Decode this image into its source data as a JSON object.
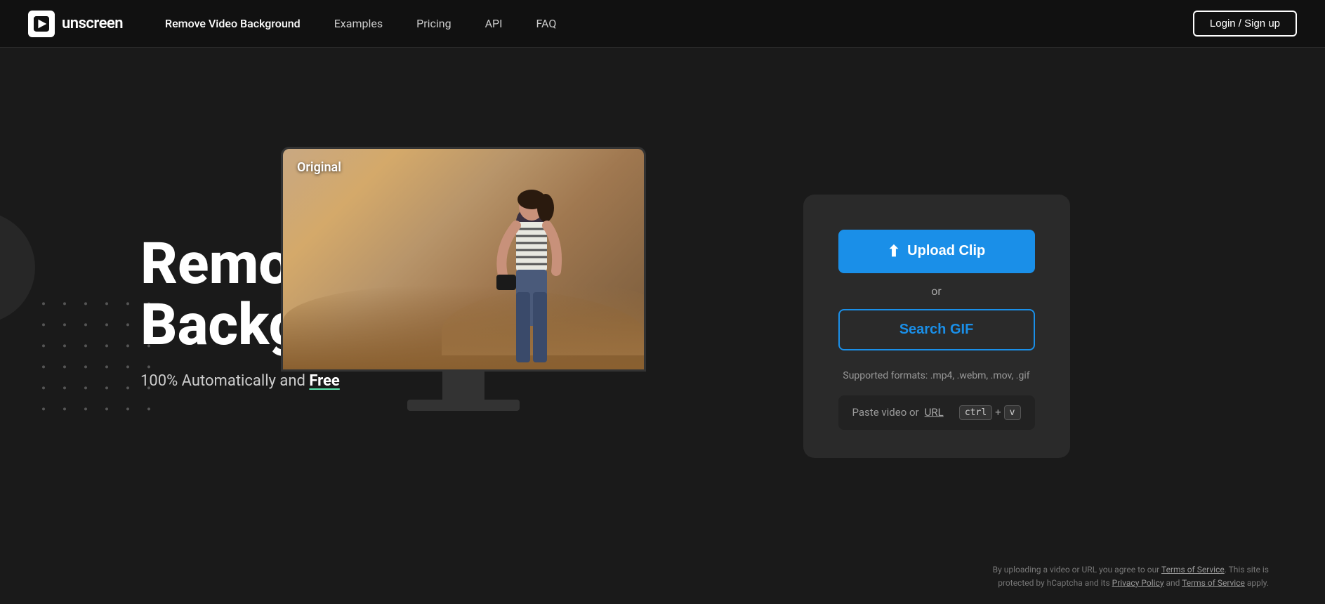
{
  "nav": {
    "logo_text": "unscreen",
    "links": [
      {
        "label": "Remove Video Background",
        "active": true
      },
      {
        "label": "Examples",
        "active": false
      },
      {
        "label": "Pricing",
        "active": false
      },
      {
        "label": "API",
        "active": false
      },
      {
        "label": "FAQ",
        "active": false
      }
    ],
    "login_label": "Login / Sign up"
  },
  "hero": {
    "title_line1": "Remove Video",
    "title_line2": "Background",
    "subtitle_prefix": "100% Automatically and ",
    "subtitle_free": "Free"
  },
  "video_preview": {
    "label": "Original"
  },
  "upload_card": {
    "upload_btn_label": "Upload Clip",
    "or_label": "or",
    "search_gif_label": "Search GIF",
    "supported_formats": "Supported formats: .mp4, .webm, .mov, .gif",
    "paste_label": "Paste video or ",
    "url_label": "URL",
    "ctrl_label": "ctrl",
    "v_label": "v"
  },
  "footer": {
    "text": "By uploading a video or URL you agree to our ",
    "tos_label": "Terms of Service",
    "middle_text": ". This site is protected by hCaptcha and its ",
    "privacy_label": "Privacy Policy",
    "and_text": " and ",
    "tos2_label": "Terms of Service",
    "end_text": " apply."
  }
}
